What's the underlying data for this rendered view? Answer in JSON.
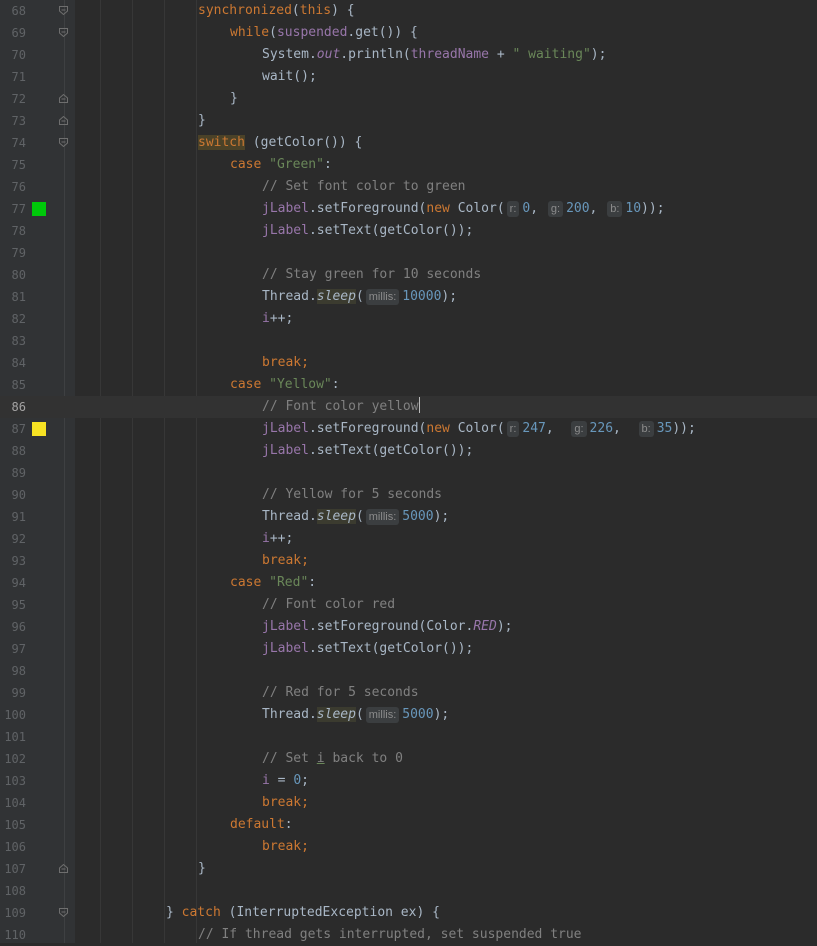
{
  "editor": {
    "colors": {
      "background": "#2b2b2b",
      "gutter": "#313335",
      "keyword": "#cc7832",
      "string": "#6a8759",
      "comment": "#808080",
      "number": "#6897bb",
      "field": "#9876aa",
      "marker_green": "#00c80a",
      "marker_yellow": "#f7e223"
    },
    "lines": [
      {
        "n": "68",
        "fold": "open",
        "t": [
          [
            "synchronized",
            "kw"
          ],
          [
            "(",
            ""
          ],
          [
            "this",
            "kw"
          ],
          [
            ") {",
            ""
          ]
        ]
      },
      {
        "n": "69",
        "fold": "open",
        "t": [
          [
            "while",
            "kw"
          ],
          [
            "(",
            ""
          ],
          [
            "suspended",
            "fld"
          ],
          [
            ".get()) {",
            ""
          ]
        ]
      },
      {
        "n": "70",
        "t": [
          [
            "System.",
            ""
          ],
          [
            "out",
            "sfld"
          ],
          [
            ".println(",
            ""
          ],
          [
            "threadName",
            "fld"
          ],
          [
            " + ",
            ""
          ],
          [
            "\" waiting\"",
            "str"
          ],
          [
            ");",
            ""
          ]
        ]
      },
      {
        "n": "71",
        "t": [
          [
            "wait();",
            ""
          ]
        ]
      },
      {
        "n": "72",
        "fold": "close",
        "t": [
          [
            "}",
            ""
          ]
        ]
      },
      {
        "n": "73",
        "fold": "close",
        "t": [
          [
            "}",
            ""
          ]
        ]
      },
      {
        "n": "74",
        "fold": "open",
        "t": [
          [
            "switch",
            "kw hl"
          ],
          [
            " (getColor()) {",
            ""
          ]
        ]
      },
      {
        "n": "75",
        "t": [
          [
            "case ",
            "kw"
          ],
          [
            "\"Green\"",
            "str"
          ],
          [
            ":",
            ""
          ]
        ]
      },
      {
        "n": "76",
        "t": [
          [
            "// Set font color to green",
            "com"
          ]
        ]
      },
      {
        "n": "77",
        "marker": "green",
        "t": [
          [
            "jLabel",
            "fld"
          ],
          [
            ".setForeground(",
            ""
          ],
          [
            "new ",
            "kw"
          ],
          [
            "Color(",
            ""
          ],
          [
            "r:",
            "hint"
          ],
          [
            "0",
            "num"
          ],
          [
            ", ",
            ""
          ],
          [
            "g:",
            "hint"
          ],
          [
            "200",
            "num"
          ],
          [
            ", ",
            ""
          ],
          [
            "b:",
            "hint"
          ],
          [
            "10",
            "num"
          ],
          [
            "));",
            ""
          ]
        ]
      },
      {
        "n": "78",
        "t": [
          [
            "jLabel",
            "fld"
          ],
          [
            ".setText(getColor());",
            ""
          ]
        ]
      },
      {
        "n": "79",
        "t": []
      },
      {
        "n": "80",
        "t": [
          [
            "// Stay green for 10 seconds",
            "com"
          ]
        ]
      },
      {
        "n": "81",
        "t": [
          [
            "Thread.",
            ""
          ],
          [
            "sleep",
            "smeth"
          ],
          [
            "(",
            ""
          ],
          [
            "millis:",
            "hint"
          ],
          [
            "10000",
            "num"
          ],
          [
            ");",
            ""
          ]
        ]
      },
      {
        "n": "82",
        "t": [
          [
            "i",
            "fld"
          ],
          [
            "++;",
            ""
          ]
        ]
      },
      {
        "n": "83",
        "t": []
      },
      {
        "n": "84",
        "t": [
          [
            "break;",
            "kw"
          ]
        ]
      },
      {
        "n": "85",
        "t": [
          [
            "case ",
            "kw"
          ],
          [
            "\"Yellow\"",
            "str"
          ],
          [
            ":",
            ""
          ]
        ]
      },
      {
        "n": "86",
        "current": true,
        "caret": true,
        "t": [
          [
            "// Font color yellow",
            "com"
          ]
        ]
      },
      {
        "n": "87",
        "marker": "yellow",
        "t": [
          [
            "jLabel",
            "fld"
          ],
          [
            ".setForeground(",
            ""
          ],
          [
            "new ",
            "kw"
          ],
          [
            "Color(",
            ""
          ],
          [
            "r:",
            "hint"
          ],
          [
            "247",
            "num"
          ],
          [
            ",  ",
            ""
          ],
          [
            "g:",
            "hint"
          ],
          [
            "226",
            "num"
          ],
          [
            ",  ",
            ""
          ],
          [
            "b:",
            "hint"
          ],
          [
            "35",
            "num"
          ],
          [
            "));",
            ""
          ]
        ]
      },
      {
        "n": "88",
        "t": [
          [
            "jLabel",
            "fld"
          ],
          [
            ".setText(getColor());",
            ""
          ]
        ]
      },
      {
        "n": "89",
        "t": []
      },
      {
        "n": "90",
        "t": [
          [
            "// Yellow for 5 seconds",
            "com"
          ]
        ]
      },
      {
        "n": "91",
        "t": [
          [
            "Thread.",
            ""
          ],
          [
            "sleep",
            "smeth"
          ],
          [
            "(",
            ""
          ],
          [
            "millis:",
            "hint"
          ],
          [
            "5000",
            "num"
          ],
          [
            ");",
            ""
          ]
        ]
      },
      {
        "n": "92",
        "t": [
          [
            "i",
            "fld"
          ],
          [
            "++;",
            ""
          ]
        ]
      },
      {
        "n": "93",
        "t": [
          [
            "break;",
            "kw"
          ]
        ]
      },
      {
        "n": "94",
        "t": [
          [
            "case ",
            "kw"
          ],
          [
            "\"Red\"",
            "str"
          ],
          [
            ":",
            ""
          ]
        ]
      },
      {
        "n": "95",
        "t": [
          [
            "// Font color red",
            "com"
          ]
        ]
      },
      {
        "n": "96",
        "t": [
          [
            "jLabel",
            "fld"
          ],
          [
            ".setForeground(Color.",
            ""
          ],
          [
            "RED",
            "sfld"
          ],
          [
            ");",
            ""
          ]
        ]
      },
      {
        "n": "97",
        "t": [
          [
            "jLabel",
            "fld"
          ],
          [
            ".setText(getColor());",
            ""
          ]
        ]
      },
      {
        "n": "98",
        "t": []
      },
      {
        "n": "99",
        "t": [
          [
            "// Red for 5 seconds",
            "com"
          ]
        ]
      },
      {
        "n": "100",
        "t": [
          [
            "Thread.",
            ""
          ],
          [
            "sleep",
            "smeth"
          ],
          [
            "(",
            ""
          ],
          [
            "millis:",
            "hint"
          ],
          [
            "5000",
            "num"
          ],
          [
            ");",
            ""
          ]
        ]
      },
      {
        "n": "101",
        "t": []
      },
      {
        "n": "102",
        "t": [
          [
            "// Set ",
            "com"
          ],
          [
            "i",
            "com und"
          ],
          [
            " back to 0",
            "com"
          ]
        ]
      },
      {
        "n": "103",
        "t": [
          [
            "i",
            "fld"
          ],
          [
            " = ",
            ""
          ],
          [
            "0",
            "num"
          ],
          [
            ";",
            ""
          ]
        ]
      },
      {
        "n": "104",
        "t": [
          [
            "break;",
            "kw"
          ]
        ]
      },
      {
        "n": "105",
        "t": [
          [
            "default",
            "kw"
          ],
          [
            ":",
            ""
          ]
        ]
      },
      {
        "n": "106",
        "t": [
          [
            "break;",
            "kw"
          ]
        ]
      },
      {
        "n": "107",
        "fold": "close",
        "t": [
          [
            "}",
            ""
          ]
        ]
      },
      {
        "n": "108",
        "t": []
      },
      {
        "n": "109",
        "fold": "open",
        "t": [
          [
            "} ",
            ""
          ],
          [
            "catch",
            "kw"
          ],
          [
            " (InterruptedException ex) {",
            ""
          ]
        ]
      },
      {
        "n": "110",
        "t": [
          [
            "// If thread gets interrupted, set suspended true",
            "com"
          ]
        ]
      }
    ]
  }
}
